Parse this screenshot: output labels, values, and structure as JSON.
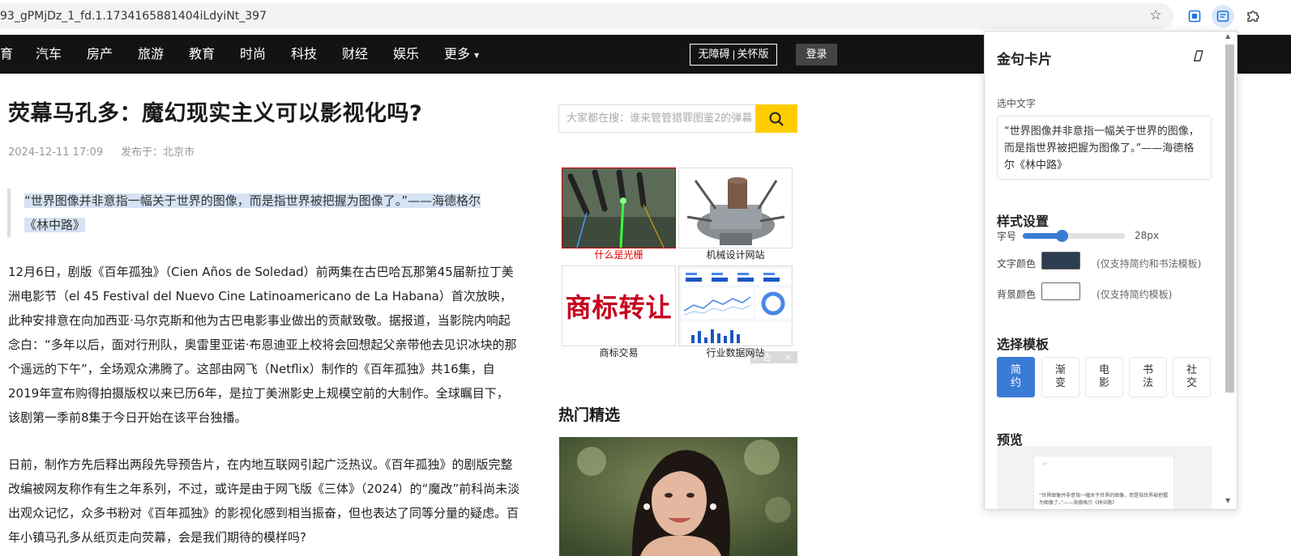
{
  "browser": {
    "url": "93_gPMjDz_1_fd.1.1734165881404iLdyiNt_397",
    "bookmark_icon": "star-icon",
    "extension_icons": [
      "extension-square-icon",
      "extension-card-icon",
      "puzzle-icon"
    ]
  },
  "nav": {
    "items": [
      "育",
      "汽车",
      "房产",
      "旅游",
      "教育",
      "时尚",
      "科技",
      "财经",
      "娱乐",
      "更多"
    ],
    "more_arrow": "▾",
    "accessibility_a": "无障碍",
    "accessibility_b": "关怀版",
    "login": "登录"
  },
  "article": {
    "title": "荧幕马孔多：魔幻现实主义可以影视化吗?",
    "date": "2024-12-11 17:09",
    "location": "发布于：北京市",
    "quote_line1": "“世界图像并非意指一幅关于世界的图像，而是指世界被把握为图像了。”——海德格尔",
    "quote_line2": "《林中路》",
    "para1": "12月6日，剧版《百年孤独》（Cien Años de Soledad）前两集在古巴哈瓦那第45届新拉丁美洲电影节（el 45 Festival del Nuevo Cine Latinoamericano de La Habana）首次放映，此种安排意在向加西亚·马尔克斯和他为古巴电影事业做出的贡献致敬。据报道，当影院内响起念白：“多年以后，面对行刑队，奥雷里亚诺·布恩迪亚上校将会回想起父亲带他去见识冰块的那个遥远的下午”，全场观众沸腾了。这部由网飞（Netflix）制作的《百年孤独》共16集，自2019年宣布购得拍摄版权以来已历6年，是拉丁美洲影史上规模空前的大制作。全球瞩目下，该剧第一季前8集于今日开始在该平台独播。",
    "para2": "日前，制作方先后释出两段先导预告片，在内地互联网引起广泛热议。《百年孤独》的剧版完整改编被网友称作有生之年系列，不过，或许是由于网飞版《三体》（2024）的“魔改”前科尚未淡出观众记忆，众多书粉对《百年孤独》的影视化感到相当振奋，但也表达了同等分量的疑虑。百年小镇马孔多从纸页走向荧幕，会是我们期待的模样吗?"
  },
  "sidebar": {
    "search_placeholder": "大家都在搜：谁来管管猎罪图鉴2的弹幕",
    "ads": [
      {
        "caption": "什么是光栅"
      },
      {
        "caption": "机械设计网站"
      },
      {
        "caption": "商标交易",
        "image_text": "商标转让"
      },
      {
        "caption": "行业数据网站"
      }
    ],
    "ad_flag": "广告",
    "ad_close": "×",
    "hot_title": "热门精选"
  },
  "panel": {
    "title": "金句卡片",
    "pin_icon": "pin-icon",
    "selected_label": "选中文字",
    "selected_text": "“世界图像并非意指一幅关于世界的图像，而是指世界被把握为图像了。”——海德格尔《林中路》",
    "style_heading": "样式设置",
    "font_size_label": "字号",
    "font_size_value": "28px",
    "font_size_fraction": 0.38,
    "text_color_label": "文字颜色",
    "text_color": "#2c3e50",
    "text_color_note": "(仅支持简约和书法模板)",
    "bg_color_label": "背景颜色",
    "bg_color": "#ffffff",
    "bg_color_note": "(仅支持简约模板)",
    "template_heading": "选择模板",
    "templates": [
      "简约",
      "渐变",
      "电影",
      "书法",
      "社交"
    ],
    "active_template": "简约",
    "preview_heading": "预览",
    "preview_quote_mark": "“",
    "preview_text": "“世界图像并非意指一幅关于世界的图像，而是指世界被把握为图像了。”——海德格尔《林中路》"
  },
  "colors": {
    "accent": "#3a7bd5",
    "nav_bg": "#131313",
    "search_btn": "#ffcc00",
    "highlight": "#d5e3f4"
  }
}
